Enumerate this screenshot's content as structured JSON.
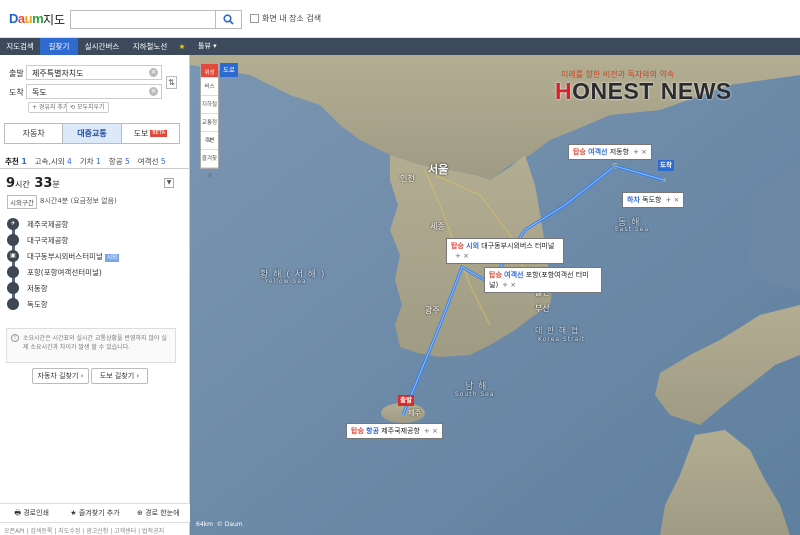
{
  "header": {
    "logo_text": "Daum",
    "logo_sub": "지도",
    "search_placeholder": "",
    "checkbox_label": "화면 내 장소 검색",
    "nav": [
      "지도검색",
      "길찾기",
      "실시간버스",
      "지하철노선",
      "★"
    ],
    "map_layer_label": "톨뷰 ▾"
  },
  "sidebar": {
    "start_label": "출발",
    "start_value": "제주특별자치도",
    "end_label": "도착",
    "end_value": "독도",
    "add_waypoint": "+ 경유지 추가",
    "clear_all": "모두지우기",
    "modes": [
      "자동차",
      "대중교통",
      "도보"
    ],
    "new_badge": "BETA",
    "tabs": [
      {
        "label": "추천",
        "count": "1"
      },
      {
        "label": "고속,시외",
        "count": "4"
      },
      {
        "label": "기차",
        "count": "1"
      },
      {
        "label": "항공",
        "count": "5"
      },
      {
        "label": "여객선",
        "count": "5"
      }
    ],
    "time_hours": "9",
    "time_hours_unit": "시간",
    "time_minutes": "33",
    "time_minutes_unit": "분",
    "fare_tag": "시외구간",
    "fare_text": "8시간4분 (요금정보 없음)",
    "stops": [
      {
        "name": "제주국제공항",
        "icon": "airplane-icon",
        "badge": ""
      },
      {
        "name": "대구국제공항",
        "icon": "",
        "badge": ""
      },
      {
        "name": "대구동부시외버스터미널",
        "icon": "bus-icon",
        "badge": "시외"
      },
      {
        "name": "포항(포항여객선터미널)",
        "icon": "",
        "badge": ""
      },
      {
        "name": "저동항",
        "icon": "",
        "badge": ""
      },
      {
        "name": "독도항",
        "icon": "",
        "badge": ""
      }
    ],
    "notice": "소요시간은 시간표와 실시간 교통상황을 반영하지 않아 실제 소요시간과 차이가 발생 할 수 있습니다.",
    "car_route_btn": "자동차 길찾기 ›",
    "walk_route_btn": "도보 길찾기 ›",
    "bottom_actions": [
      "경로인쇄",
      "즐겨찾기 추가",
      "경로 한눈에"
    ],
    "footer_links": "오픈API | 검색등록 | 지도수정 | 광고신청 | 고객센터 | 법적공지"
  },
  "map": {
    "tools": [
      "버스",
      "지하철",
      "교통정보",
      "주변",
      "즐겨찾기"
    ],
    "satellite_toggle": [
      "위성",
      "도로"
    ],
    "news_tagline": "미래를 향한 비전과 독자와의 약속",
    "news_brand_h": "H",
    "news_brand_rest": "ONEST NEWS",
    "labels": {
      "seoul": "서울",
      "incheon": "인천",
      "sejong": "세종",
      "gwangju": "광주",
      "busan": "부산",
      "daegu": "대구",
      "ulsan": "울산",
      "yellow_sea": "황 해 ( 서 해 )",
      "yellow_sea_en": "Yellow Sea",
      "east_sea": "동 해",
      "east_sea_en": "East Sea",
      "south_sea": "남 해",
      "south_sea_en": "South Sea",
      "korea_strait": "대 한 해 협",
      "korea_strait_en": "Korea Strait",
      "jeju": "제주"
    },
    "popups": [
      {
        "action": "탑승",
        "type": "여객선",
        "name": "저동항"
      },
      {
        "action": "하차",
        "type": "",
        "name": "독도항"
      },
      {
        "action": "탑승",
        "type": "시외",
        "name": "대구동부시외버스 터미널"
      },
      {
        "action": "탑승",
        "type": "여객선",
        "name": "포항(포항여객선 터미널)"
      },
      {
        "action": "탑승",
        "type": "항공",
        "name": "제주국제공항"
      }
    ],
    "flag_start": "출발",
    "flag_end": "도착",
    "scale_label": "64km",
    "copyright": "© Daum"
  }
}
